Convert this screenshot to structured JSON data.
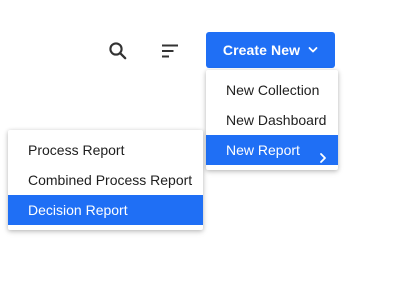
{
  "toolbar": {
    "search_icon": "search-icon",
    "sort_icon": "sort-icon",
    "create_button_label": "Create New"
  },
  "create_menu": {
    "items": [
      {
        "label": "New Collection"
      },
      {
        "label": "New Dashboard"
      },
      {
        "label": "New Report"
      }
    ],
    "active_item": "New Report"
  },
  "report_submenu": {
    "items": [
      {
        "label": "Process Report"
      },
      {
        "label": "Combined Process Report"
      },
      {
        "label": "Decision Report"
      }
    ],
    "active_item": "Decision Report"
  },
  "colors": {
    "accent": "#1f6ff5",
    "text": "#1e1e1e",
    "icon": "#333333"
  }
}
